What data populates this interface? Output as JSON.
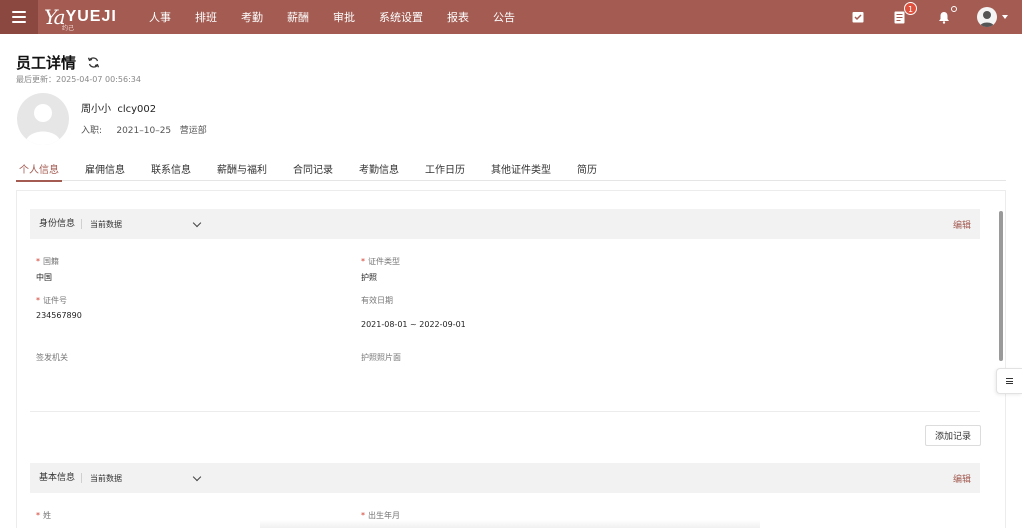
{
  "topbar": {
    "nav": [
      "人事",
      "排班",
      "考勤",
      "薪酬",
      "审批",
      "系统设置",
      "报表",
      "公告"
    ],
    "logo_mark": "Ya",
    "logo_word": "YUEJI",
    "logo_small": "约己",
    "task_badge": "1",
    "accent_color": "#a35b52"
  },
  "header": {
    "title": "员工详情",
    "last_update": "最后更新：2025-04-07 00:56:34",
    "employee": {
      "name_line": "周小小  clcy002",
      "meta_line": "入职:     2021–10–25   营运部"
    }
  },
  "tabs": [
    "个人信息",
    "雇佣信息",
    "联系信息",
    "薪酬与福利",
    "合同记录",
    "考勤信息",
    "工作日历",
    "其他证件类型",
    "简历"
  ],
  "identity": {
    "title": "身份信息",
    "select": "当前数据",
    "edit": "编辑",
    "fields": {
      "nationality_label": "国籍",
      "nationality_value": "中国",
      "doc_type_label": "证件类型",
      "doc_type_value": "护照",
      "doc_no_label": "证件号",
      "doc_no_value": "234567890",
      "valid_label": "有效日期",
      "valid_value": "2021-08-01 ~ 2022-09-01",
      "issuer_label": "签发机关",
      "photo_label": "护照照片面"
    },
    "add_record": "添加记录"
  },
  "basic": {
    "title": "基本信息",
    "select": "当前数据",
    "edit": "编辑",
    "left_label": "姓",
    "right_label": "出生年月"
  }
}
